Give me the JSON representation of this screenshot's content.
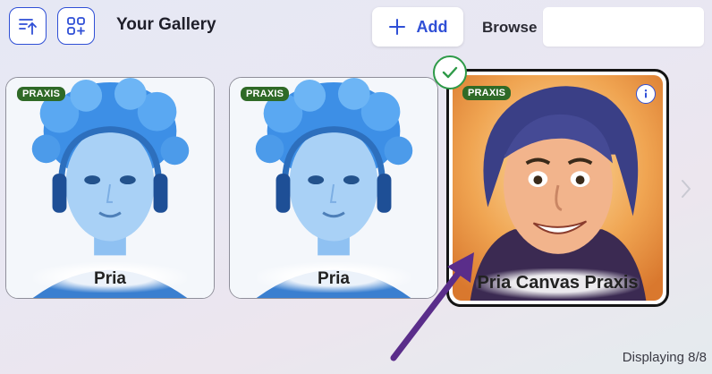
{
  "header": {
    "title": "Your Gallery",
    "add_label": "Add",
    "browse_label": "Browse",
    "browse_value": "",
    "icons": {
      "sort": "sort-upload-icon",
      "grid": "grid-add-icon",
      "plus": "plus-icon"
    }
  },
  "cards": [
    {
      "badge": "PRAXIS",
      "name": "Pria",
      "selected": false
    },
    {
      "badge": "PRAXIS",
      "name": "Pria",
      "selected": false
    },
    {
      "badge": "PRAXIS",
      "name": "Pria Canvas Praxis",
      "selected": true
    }
  ],
  "status": {
    "text": "Displaying 8/8"
  },
  "colors": {
    "accent": "#2f4fd6",
    "badge": "#2f6a27",
    "check": "#2e9a48",
    "arrow": "#5a2d8a"
  }
}
